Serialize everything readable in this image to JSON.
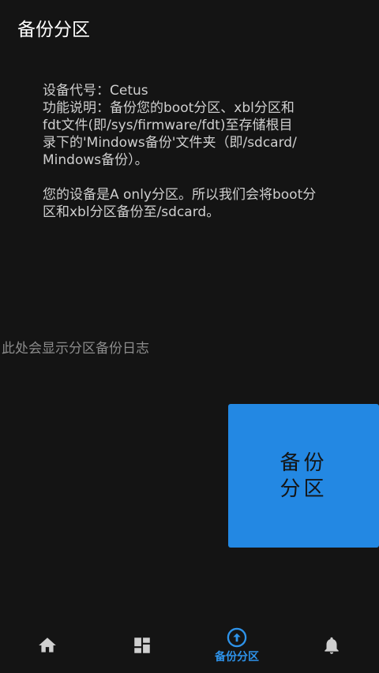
{
  "app": {
    "title": "备份分区"
  },
  "info": {
    "device_line": "设备代号：Cetus",
    "description_lines": [
      "功能说明：备份您的boot分区、xbl分区和",
      "fdt文件(即/sys/firmware/fdt)至存储根目",
      "录下的'Mindows备份'文件夹（即/sdcard/",
      "Mindows备份）。"
    ],
    "slot_lines": [
      "您的设备是A only分区。所以我们会将boot分",
      "区和xbl分区备份至/sdcard。"
    ]
  },
  "log": {
    "placeholder": "此处会显示分区备份日志"
  },
  "backup_button": {
    "label": "备份分区",
    "color": "#2388e3"
  },
  "bottom_nav": {
    "accent_color": "#2e93ea",
    "items": [
      {
        "icon": "home-icon",
        "label": ""
      },
      {
        "icon": "dashboard-icon",
        "label": ""
      },
      {
        "icon": "upload-circle-icon",
        "label": "备份分区",
        "active": true
      },
      {
        "icon": "bell-icon",
        "label": ""
      }
    ]
  }
}
